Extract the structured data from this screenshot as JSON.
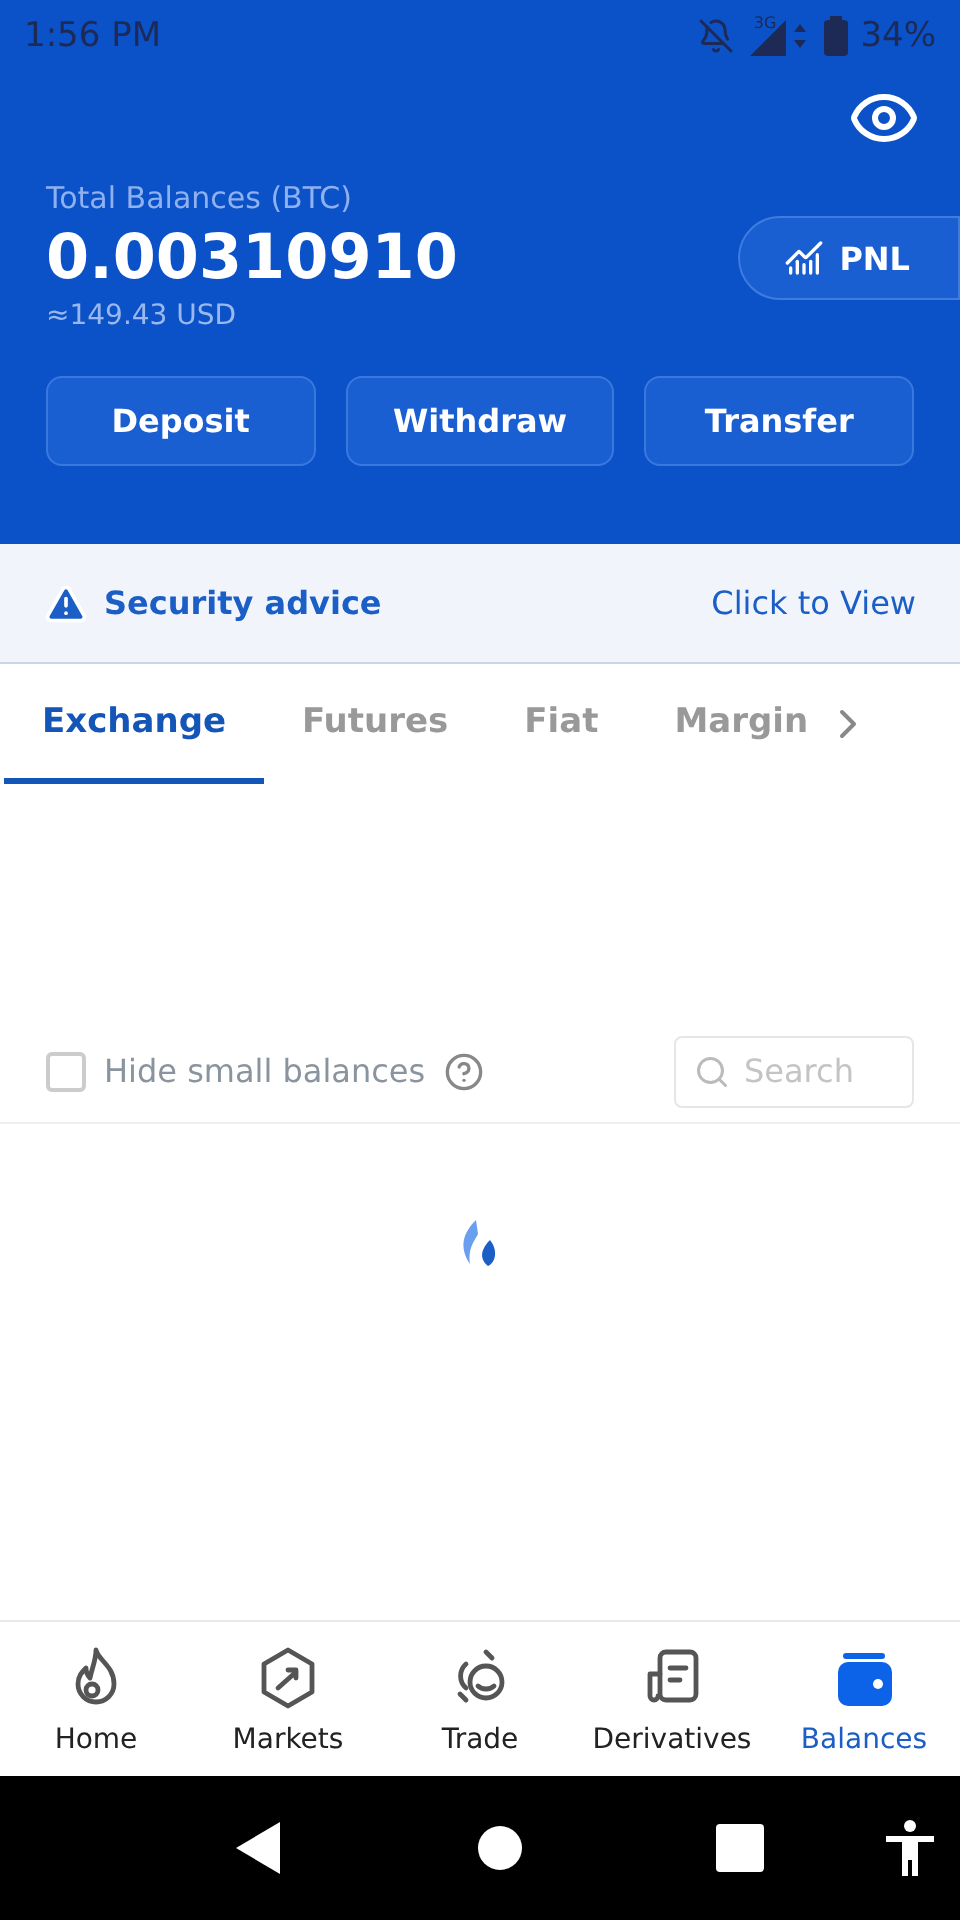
{
  "status_bar": {
    "time": "1:56 PM",
    "network": "3G",
    "battery": "34%"
  },
  "header": {
    "label": "Total Balances (BTC)",
    "amount": "0.00310910",
    "fiat": "≈149.43 USD",
    "pnl_button": "PNL",
    "actions": [
      "Deposit",
      "Withdraw",
      "Transfer"
    ]
  },
  "banner": {
    "title": "Security advice",
    "link": "Click to View"
  },
  "tabs": [
    {
      "label": "Exchange",
      "selected": true
    },
    {
      "label": "Futures",
      "selected": false
    },
    {
      "label": "Fiat",
      "selected": false
    },
    {
      "label": "Margin",
      "selected": false
    }
  ],
  "filter": {
    "hide_small": {
      "label": "Hide small balances",
      "checked": false
    },
    "search": {
      "placeholder": "Search"
    }
  },
  "bottom_nav": [
    {
      "label": "Home",
      "kind": "home",
      "selected": false
    },
    {
      "label": "Markets",
      "kind": "markets",
      "selected": false
    },
    {
      "label": "Trade",
      "kind": "trade",
      "selected": false
    },
    {
      "label": "Derivatives",
      "kind": "derivatives",
      "selected": false
    },
    {
      "label": "Balances",
      "kind": "balances",
      "selected": true
    }
  ]
}
